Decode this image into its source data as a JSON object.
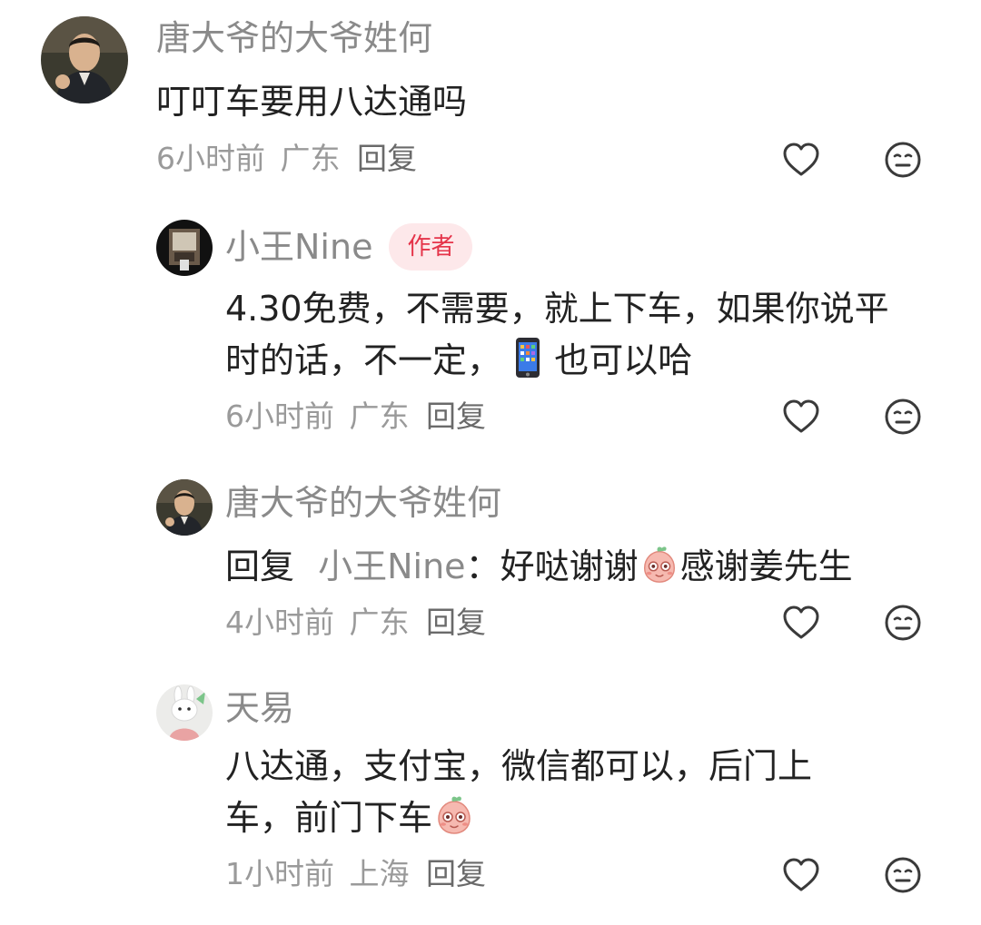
{
  "comments": [
    {
      "name": "唐大爷的大爷姓何",
      "text": "叮叮车要用八达通吗",
      "time": "6小时前",
      "location": "广东",
      "reply_label": "回复"
    },
    {
      "name": "小王Nine",
      "badge": "作者",
      "text_line1": "4.30免费，不需要，就上下车，如果你说平",
      "text_line2_a": "时的话，不一定，",
      "text_line2_b": "也可以哈",
      "time": "6小时前",
      "location": "广东",
      "reply_label": "回复"
    },
    {
      "name": "唐大爷的大爷姓何",
      "reply_prefix": "回复",
      "reply_target": "小王Nine",
      "text_a": "：好哒谢谢",
      "text_b": "感谢姜先生",
      "time": "4小时前",
      "location": "广东",
      "reply_label": "回复"
    },
    {
      "name": "天易",
      "text_line1": "八达通，支付宝，微信都可以，后门上",
      "text_line2": "车，前门下车",
      "time": "1小时前",
      "location": "上海",
      "reply_label": "回复"
    }
  ],
  "icons": {
    "like": "heart-outline-icon",
    "dislike": "neutral-face-icon"
  },
  "colors": {
    "badge_bg": "#fde8ea",
    "badge_text": "#e5344a",
    "meta": "#9a9a9a"
  }
}
